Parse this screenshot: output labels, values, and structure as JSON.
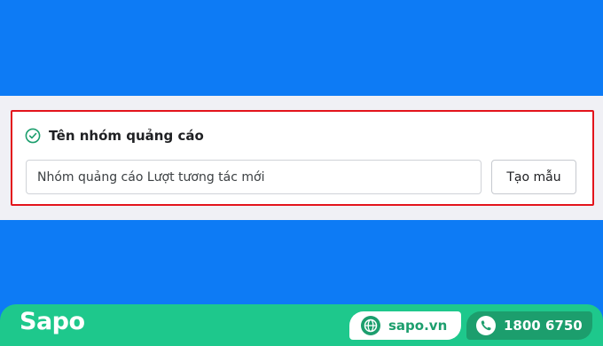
{
  "colors": {
    "background": "#0d7bf5",
    "panel": "#f0f0f5",
    "highlight_border": "#e3141c",
    "footer": "#1ec88c",
    "footer_dark": "#1c9e6d",
    "check": "#1c9e6d"
  },
  "ad_group": {
    "section_icon": "check-circle-icon",
    "section_title": "Tên nhóm quảng cáo",
    "name_value": "Nhóm quảng cáo Lượt tương tác mới",
    "template_button_label": "Tạo mẫu"
  },
  "footer": {
    "logo_text": "Sapo",
    "website_icon": "globe-icon",
    "website": "sapo.vn",
    "phone_icon": "phone-icon",
    "phone": "1800 6750"
  }
}
